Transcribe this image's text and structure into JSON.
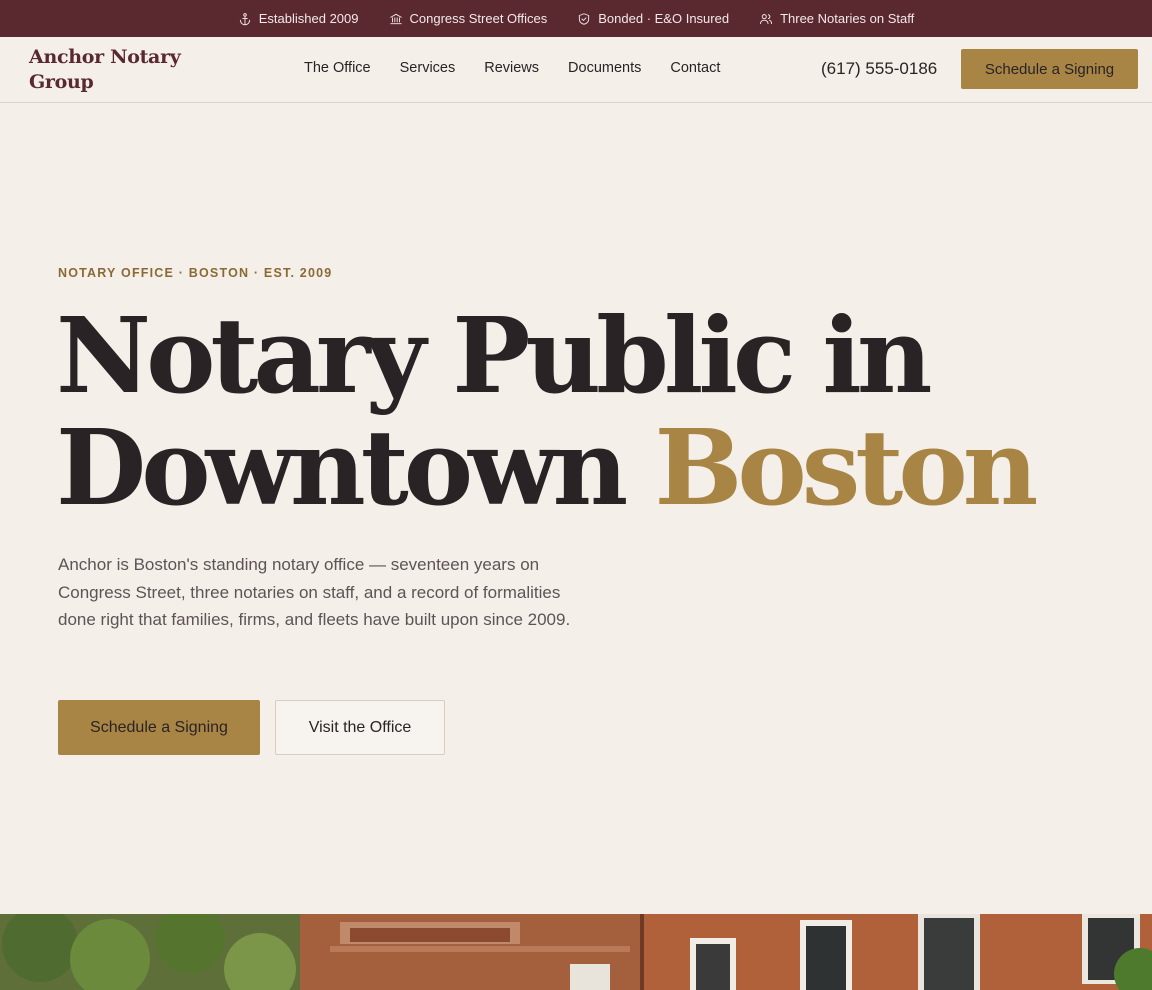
{
  "topbar": {
    "items": [
      {
        "icon": "anchor-icon",
        "label": "Established 2009"
      },
      {
        "icon": "bank-icon",
        "label": "Congress Street Offices"
      },
      {
        "icon": "shield-check-icon",
        "label": "Bonded · E&O Insured"
      },
      {
        "icon": "users-icon",
        "label": "Three Notaries on Staff"
      }
    ]
  },
  "header": {
    "logo_line1": "Anchor Notary",
    "logo_line2": "Group",
    "nav": [
      "The Office",
      "Services",
      "Reviews",
      "Documents",
      "Contact"
    ],
    "phone": "(617) 555-0186",
    "cta": "Schedule a Signing"
  },
  "hero": {
    "eyebrow": "NOTARY OFFICE · BOSTON · EST. 2009",
    "headline_line1": "Notary Public in",
    "headline_line2_main": "Downtown",
    "headline_line2_accent": "Boston",
    "lede": "Anchor is Boston's standing notary office — seventeen years on Congress Street, three notaries on staff, and a record of formalities done right that families, firms, and fleets have built upon since 2009.",
    "primary_button": "Schedule a Signing",
    "secondary_button": "Visit the Office"
  },
  "colors": {
    "topbar_bg": "#5a2930",
    "page_bg": "#f4efe8",
    "accent_gold": "#a88544",
    "text_dark": "#2a2326"
  }
}
